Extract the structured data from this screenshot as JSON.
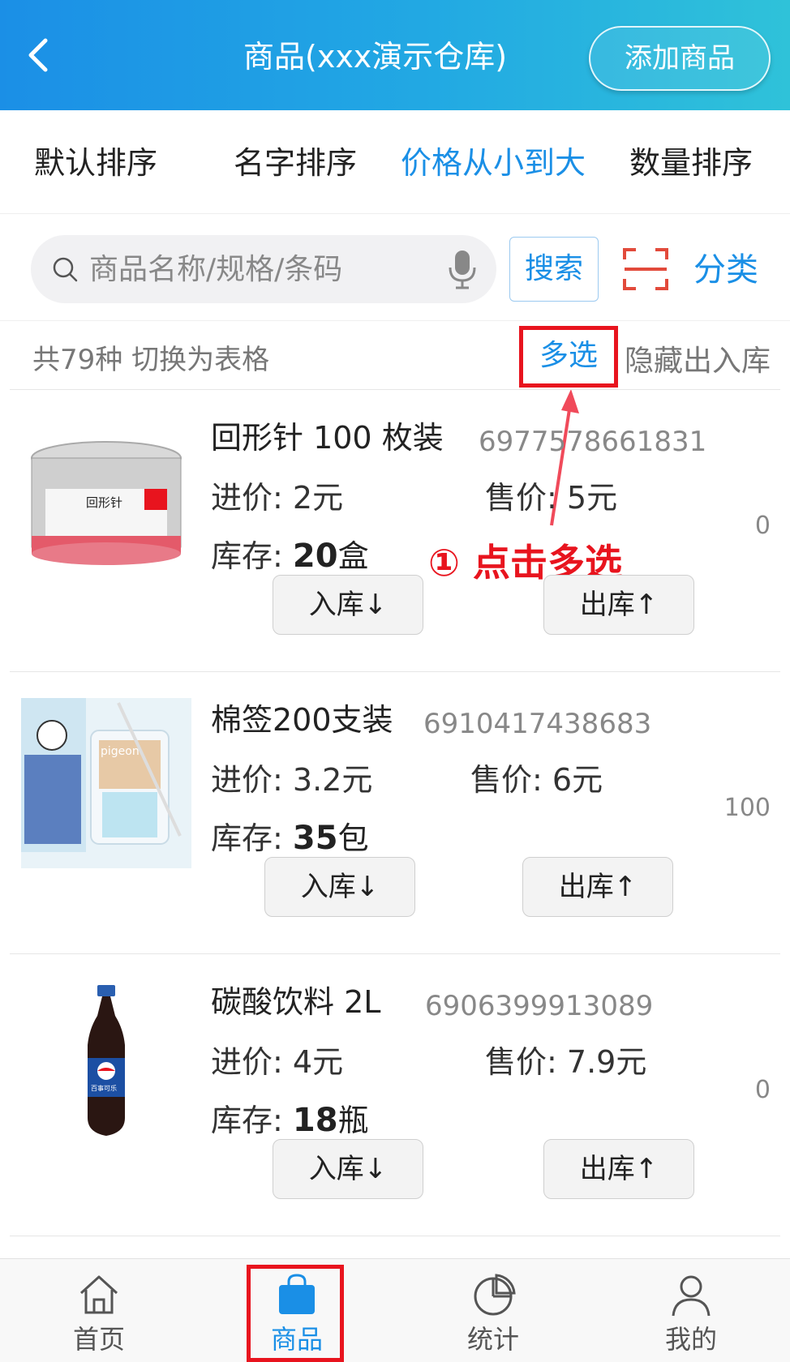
{
  "header": {
    "title": "商品(xxx演示仓库)",
    "add_button": "添加商品",
    "back_icon": "chevron-left-icon"
  },
  "sort_tabs": [
    {
      "label": "默认排序",
      "active": false
    },
    {
      "label": "名字排序",
      "active": false
    },
    {
      "label": "价格从小到大",
      "active": true
    },
    {
      "label": "数量排序",
      "active": false
    }
  ],
  "search": {
    "placeholder": "商品名称/规格/条码",
    "value": "",
    "button": "搜索",
    "category": "分类"
  },
  "info_row": {
    "summary": "共79种  切换为表格",
    "multi_select": "多选",
    "hide_inout": "隐藏出入库"
  },
  "annotation": {
    "text": "① 点击多选",
    "color": "#e8141e"
  },
  "labels": {
    "buy_price": "进价: ",
    "sell_price": "售价: ",
    "stock": "库存: ",
    "in_button": "入库↓",
    "out_button": "出库↑"
  },
  "products": [
    {
      "name": "回形针  100 枚装",
      "barcode": "6977578661831",
      "buy": "2元",
      "sell": "5元",
      "stock_qty": "20",
      "stock_unit": "盒",
      "side_count": "0",
      "image_text": "回形针"
    },
    {
      "name": "棉签200支装",
      "barcode": "6910417438683",
      "buy": "3.2元",
      "sell": "6元",
      "stock_qty": "35",
      "stock_unit": "包",
      "side_count": "100",
      "image_text": "pigeon"
    },
    {
      "name": "碳酸饮料  2L",
      "barcode": "6906399913089",
      "buy": "4元",
      "sell": "7.9元",
      "stock_qty": "18",
      "stock_unit": "瓶",
      "side_count": "0",
      "image_text": "百事可乐"
    }
  ],
  "bottom_nav": [
    {
      "label": "首页",
      "icon": "home-icon",
      "active": false
    },
    {
      "label": "商品",
      "icon": "shopping-bag-icon",
      "active": true
    },
    {
      "label": "统计",
      "icon": "pie-chart-icon",
      "active": false
    },
    {
      "label": "我的",
      "icon": "user-icon",
      "active": false
    }
  ],
  "colors": {
    "accent": "#1a8fe6",
    "highlight": "#e8141e",
    "header_start": "#1b8fe6",
    "header_end": "#2fc2d9"
  }
}
